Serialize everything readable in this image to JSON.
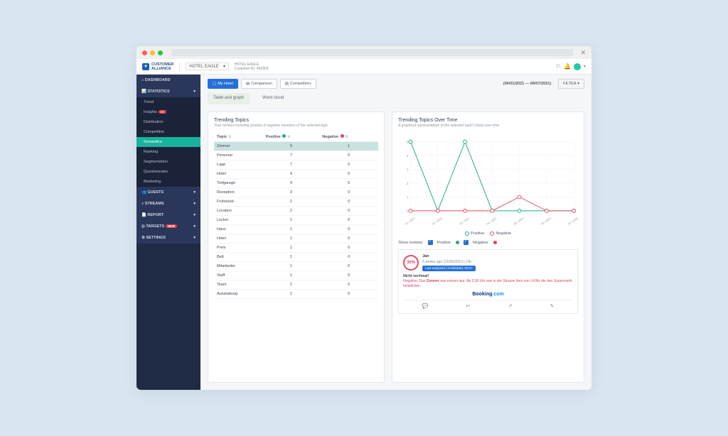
{
  "header": {
    "brand1": "CUSTOMER",
    "brand2": "ALLIANCE",
    "hotel_label": "HOTEL EAGLE",
    "hotel_name": "HOTEL EAGLE",
    "customer_id": "Customer ID: 491803"
  },
  "sidebar": {
    "dashboard": "DASHBOARD",
    "statistics": "STATISTICS",
    "subs": {
      "trend": "Trend",
      "insights": "Insights",
      "insights_badge": "19",
      "distribution": "Distribution",
      "competition": "Competition",
      "semantics": "Semantics",
      "ranking": "Ranking",
      "segmentation": "Segmentation",
      "questionnaire": "Questionnaire",
      "marketing": "Marketing"
    },
    "guests": "GUESTS",
    "streams": "STREAMS",
    "report": "REPORT",
    "targets": "TARGETS",
    "targets_badge": "new",
    "settings": "SETTINGS"
  },
  "toolbar": {
    "my_hotel": "My Hotel",
    "comparison": "Comparison",
    "competitors": "Competitors",
    "date_range": "(06/01/2021 — 06/07/2021)",
    "filter": "FILTER"
  },
  "subtabs": {
    "table_graph": "Table and graph",
    "word_cloud": "Word cloud"
  },
  "trending": {
    "title": "Trending Topics",
    "subtitle": "Your reviews including positive & negative mentions of the selected topic",
    "cols": {
      "topic": "Topic",
      "positive": "Positive",
      "negative": "Negative"
    },
    "rows": [
      {
        "t": "Zimmer",
        "p": "9",
        "n": "1"
      },
      {
        "t": "Personal",
        "p": "7",
        "n": "0"
      },
      {
        "t": "Lage",
        "p": "7",
        "n": "0"
      },
      {
        "t": "Hotel",
        "p": "4",
        "n": "0"
      },
      {
        "t": "Tiefgarage",
        "p": "4",
        "n": "0"
      },
      {
        "t": "Rezeption",
        "p": "3",
        "n": "0"
      },
      {
        "t": "Frühstück",
        "p": "2",
        "n": "0"
      },
      {
        "t": "Location",
        "p": "2",
        "n": "0"
      },
      {
        "t": "Lecker",
        "p": "1",
        "n": "0"
      },
      {
        "t": "Haus",
        "p": "1",
        "n": "0"
      },
      {
        "t": "Hotel",
        "p": "1",
        "n": "0"
      },
      {
        "t": "Preis",
        "p": "1",
        "n": "0"
      },
      {
        "t": "Bett",
        "p": "1",
        "n": "0"
      },
      {
        "t": "Mitarbeiter",
        "p": "1",
        "n": "0"
      },
      {
        "t": "Staff",
        "p": "1",
        "n": "0"
      },
      {
        "t": "Team",
        "p": "1",
        "n": "0"
      },
      {
        "t": "Ausstattung",
        "p": "1",
        "n": "0"
      }
    ]
  },
  "over_time": {
    "title": "Trending Topics Over Time",
    "subtitle": "A graphical representation of the selected topic's trend over time",
    "legend_pos": "Positive",
    "legend_neg": "Negative",
    "filter_label": "Show reviews:",
    "filter_pos": "Positive",
    "filter_neg": "Negative"
  },
  "chart_data": {
    "type": "line",
    "x": [
      "01 / 2021",
      "02 / 2021",
      "03 / 2021",
      "04 / 2021",
      "05 / 2021",
      "06 / 2021",
      "07 / 2021"
    ],
    "series": [
      {
        "name": "Positive",
        "values": [
          5,
          0,
          5,
          0,
          0,
          0,
          0
        ]
      },
      {
        "name": "Negative",
        "values": [
          0,
          0,
          0,
          0,
          1,
          0,
          0
        ]
      }
    ],
    "ylim": [
      0,
      5
    ],
    "ylabel": "",
    "xlabel": ""
  },
  "review": {
    "score": "30%",
    "name": "Jan",
    "meta_line": "5 weeks ago (31/05/2021)  |  DE",
    "analysed": "Last analysed | 01/06/2021 00:07",
    "title": "Nicht nochmal!",
    "neg_label": "Negative:",
    "text1": " Das ",
    "highlight": "Zimmer",
    "text2": " war extrem laut. Ab 3.30 Uhr war in der Strasse lärm von LKWs die den Supermarkt belieferten.",
    "source1": "Booking",
    "source2": ".com"
  }
}
